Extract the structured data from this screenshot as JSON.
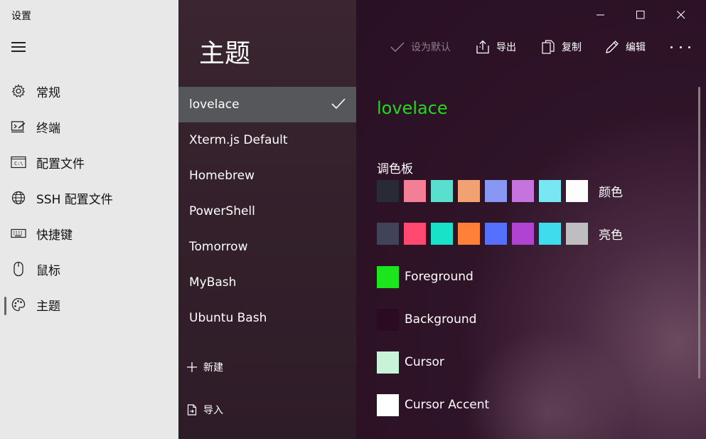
{
  "app": {
    "title": "设置"
  },
  "nav": {
    "items": [
      {
        "label": "常规",
        "icon": "gear-icon"
      },
      {
        "label": "终端",
        "icon": "terminal-icon"
      },
      {
        "label": "配置文件",
        "icon": "profile-window-icon"
      },
      {
        "label": "SSH 配置文件",
        "icon": "globe-icon"
      },
      {
        "label": "快捷键",
        "icon": "keyboard-icon"
      },
      {
        "label": "鼠标",
        "icon": "mouse-icon"
      },
      {
        "label": "主题",
        "icon": "palette-icon"
      }
    ],
    "selected": "主题"
  },
  "list": {
    "title": "主题",
    "themes": [
      "lovelace",
      "Xterm.js Default",
      "Homebrew",
      "PowerShell",
      "Tomorrow",
      "MyBash",
      "Ubuntu Bash"
    ],
    "selected": "lovelace",
    "new_label": "新建",
    "import_label": "导入"
  },
  "toolbar": {
    "set_default": "设为默认",
    "export": "导出",
    "copy": "复制",
    "edit": "编辑"
  },
  "panel": {
    "theme_name": "lovelace",
    "palette_title": "调色板",
    "normal_label": "颜色",
    "bright_label": "亮色",
    "normal_colors": [
      "#282a36",
      "#f37f97",
      "#5adecd",
      "#f2a272",
      "#8897f4",
      "#c574dd",
      "#79e6f3",
      "#fdfdfd"
    ],
    "bright_colors": [
      "#414458",
      "#ff4971",
      "#18e3c8",
      "#ff8037",
      "#556fff",
      "#b043d1",
      "#3fdcee",
      "#bebec1"
    ],
    "attributes": [
      {
        "label": "Foreground",
        "color": "#1de51d"
      },
      {
        "label": "Background",
        "color": "#2b0a22"
      },
      {
        "label": "Cursor",
        "color": "#c9f3d9"
      },
      {
        "label": "Cursor Accent",
        "color": "#ffffff"
      }
    ]
  }
}
